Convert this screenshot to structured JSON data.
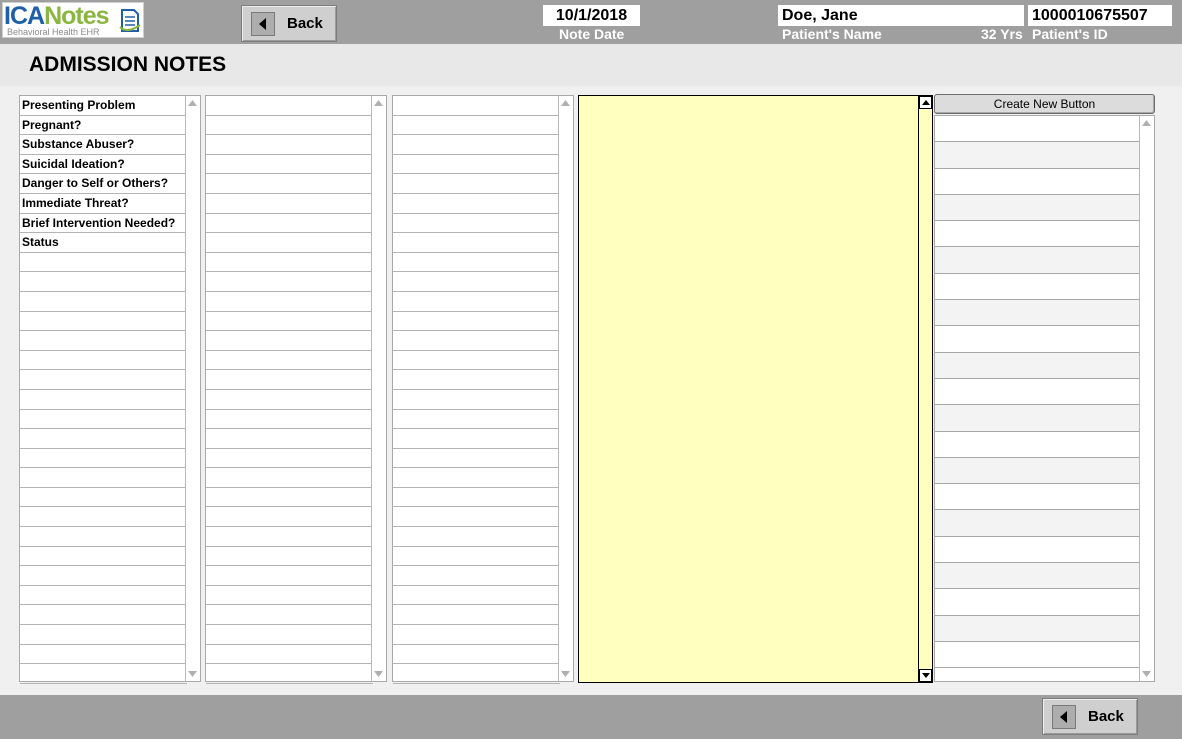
{
  "header": {
    "logo": {
      "brand_main": "ICA",
      "brand_accent": "Notes",
      "tagline": "Behavioral Health EHR"
    },
    "back_label": "Back",
    "note_date_value": "10/1/2018",
    "note_date_caption": "Note Date",
    "patient_name_value": "Doe, Jane",
    "patient_name_caption": "Patient's Name",
    "patient_age": "32 Yrs",
    "patient_id_value": "1000010675507",
    "patient_id_caption": "Patient's ID"
  },
  "page": {
    "title": "ADMISSION NOTES"
  },
  "questions": [
    "Presenting Problem",
    "Pregnant?",
    "Substance Abuser?",
    "Suicidal Ideation?",
    "Danger to Self or Others?",
    "Immediate Threat?",
    "Brief Intervention Needed?",
    "Status"
  ],
  "right_panel": {
    "create_button_label": "Create New  Button"
  },
  "footer": {
    "back_label": "Back"
  },
  "colors": {
    "header_bar": "#9f9f9f",
    "note_background": "#ffffc0",
    "logo_blue": "#1f5fa8",
    "logo_green": "#8ab640"
  },
  "icons": [
    "back-arrow-icon",
    "scroll-up-icon",
    "scroll-down-icon",
    "notes-document-icon"
  ]
}
